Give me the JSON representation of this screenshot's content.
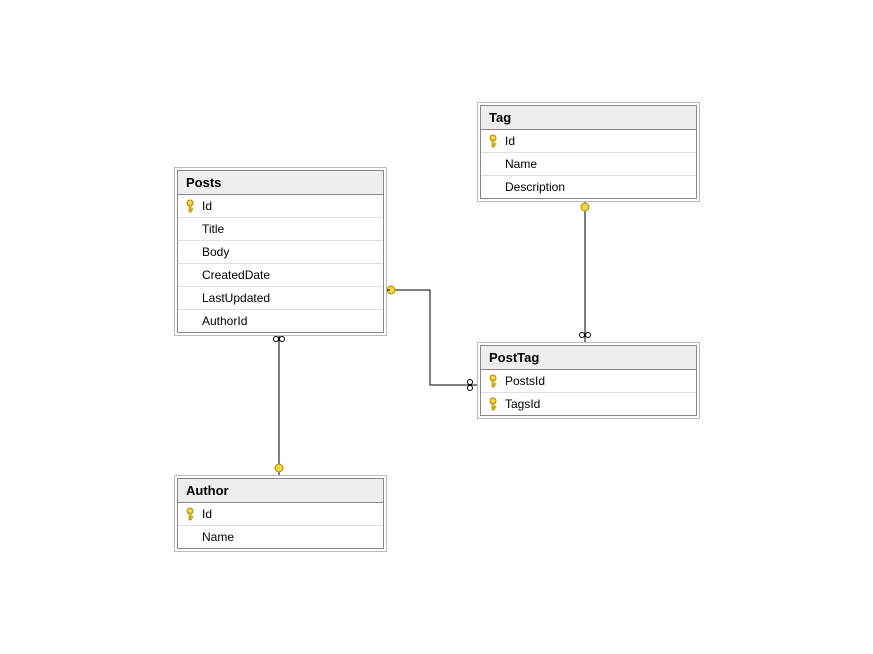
{
  "entities": {
    "posts": {
      "title": "Posts",
      "columns": [
        {
          "name": "Id",
          "pk": true
        },
        {
          "name": "Title",
          "pk": false
        },
        {
          "name": "Body",
          "pk": false
        },
        {
          "name": "CreatedDate",
          "pk": false
        },
        {
          "name": "LastUpdated",
          "pk": false
        },
        {
          "name": "AuthorId",
          "pk": false
        }
      ]
    },
    "tag": {
      "title": "Tag",
      "columns": [
        {
          "name": "Id",
          "pk": true
        },
        {
          "name": "Name",
          "pk": false
        },
        {
          "name": "Description",
          "pk": false
        }
      ]
    },
    "posttag": {
      "title": "PostTag",
      "columns": [
        {
          "name": "PostsId",
          "pk": true
        },
        {
          "name": "TagsId",
          "pk": true
        }
      ]
    },
    "author": {
      "title": "Author",
      "columns": [
        {
          "name": "Id",
          "pk": true
        },
        {
          "name": "Name",
          "pk": false
        }
      ]
    }
  },
  "relationships": [
    {
      "from": "posts",
      "to": "author",
      "kind": "many-to-one"
    },
    {
      "from": "posts",
      "to": "posttag",
      "kind": "one-to-many"
    },
    {
      "from": "tag",
      "to": "posttag",
      "kind": "one-to-many"
    }
  ],
  "colors": {
    "entity_border": "#888888",
    "entity_header": "#eeeeee",
    "key_fill": "#f5d742",
    "key_stroke": "#a88a00",
    "line": "#000000"
  }
}
